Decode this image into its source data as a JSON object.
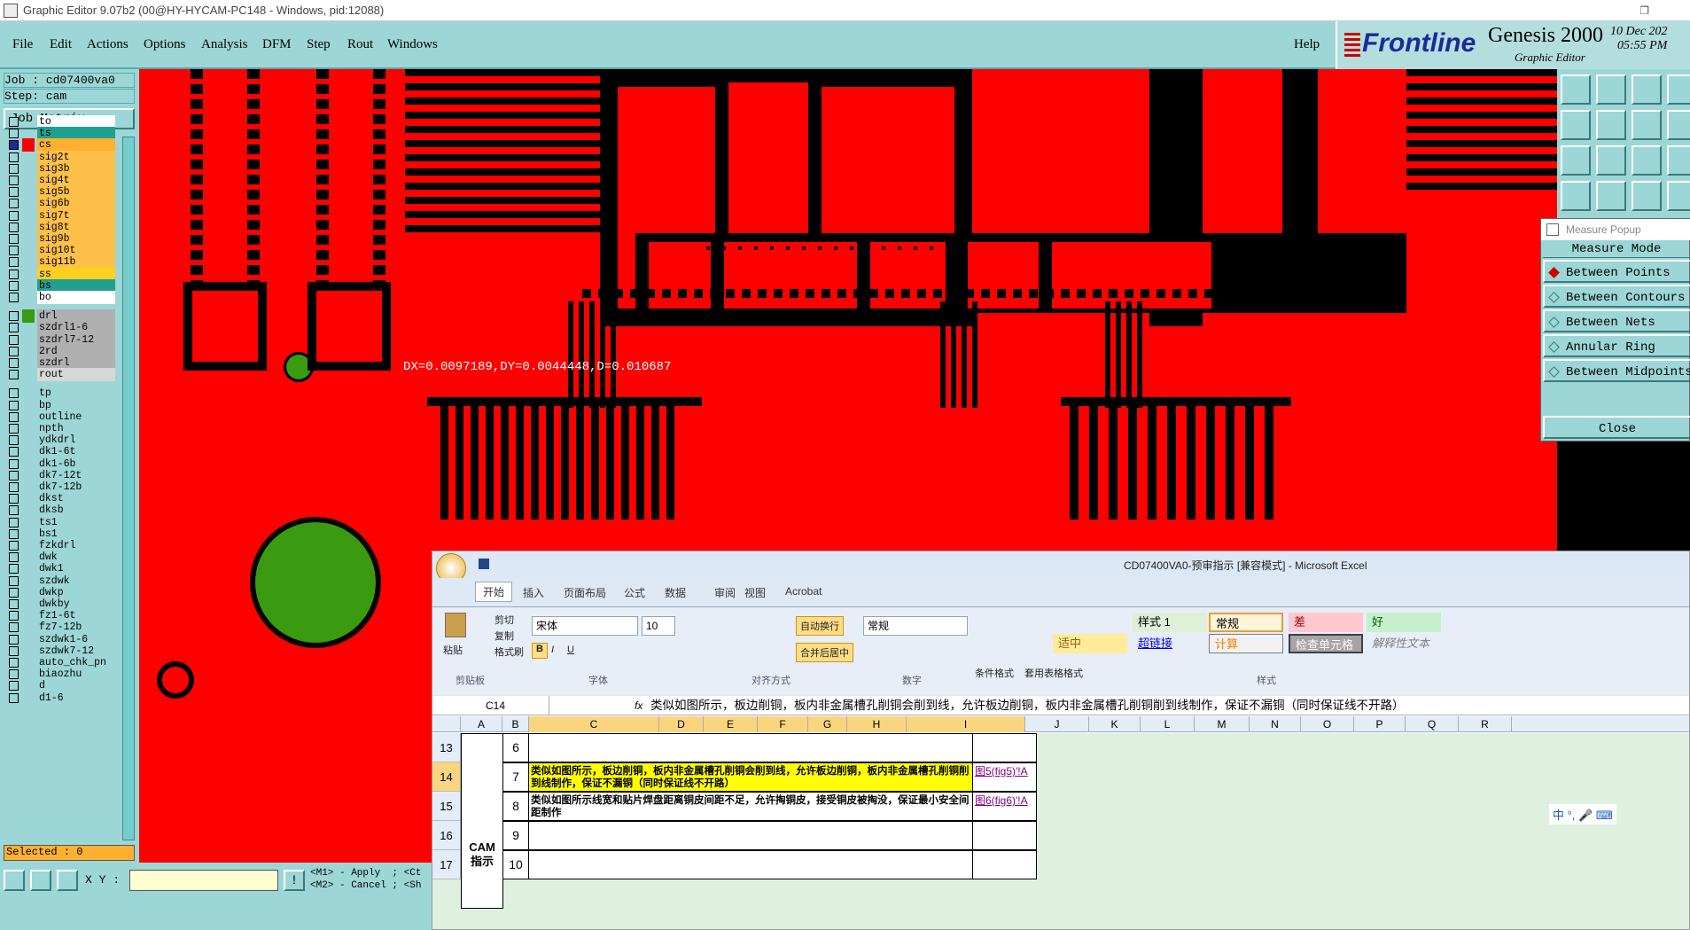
{
  "window": {
    "title": "Graphic Editor 9.07b2 (00@HY-HYCAM-PC148 - Windows, pid:12088)"
  },
  "menu": [
    "File",
    "Edit",
    "Actions",
    "Options",
    "Analysis",
    "DFM",
    "Step",
    "Rout",
    "Windows"
  ],
  "help_label": "Help",
  "brand": {
    "logo": "Frontline",
    "product": "Genesis 2000",
    "subtitle": "Graphic Editor",
    "date": "10 Dec 202",
    "time": "05:55 PM"
  },
  "job": {
    "job_label": "Job : cd07400va0",
    "step_label": "Step: cam",
    "matrix_button": "Job Matrix ..."
  },
  "layers_group1": [
    {
      "name": "to",
      "color": "#ffffff"
    },
    {
      "name": "ts",
      "color": "#20a090"
    },
    {
      "name": "cs",
      "color": "#ffb030"
    },
    {
      "name": "sig2t",
      "color": "#ffc04a"
    },
    {
      "name": "sig3b",
      "color": "#ffc04a"
    },
    {
      "name": "sig4t",
      "color": "#ffc04a"
    },
    {
      "name": "sig5b",
      "color": "#ffc04a"
    },
    {
      "name": "sig6b",
      "color": "#ffc04a"
    },
    {
      "name": "sig7t",
      "color": "#ffc04a"
    },
    {
      "name": "sig8t",
      "color": "#ffc04a"
    },
    {
      "name": "sig9b",
      "color": "#ffc04a"
    },
    {
      "name": "sig10t",
      "color": "#ffc04a"
    },
    {
      "name": "sig11b",
      "color": "#ffc04a"
    },
    {
      "name": "ss",
      "color": "#ffd020"
    },
    {
      "name": "bs",
      "color": "#20a090"
    },
    {
      "name": "bo",
      "color": "#ffffff"
    }
  ],
  "layers_group2": [
    {
      "name": "drl",
      "color": "#b0b0b0"
    },
    {
      "name": "szdrl1-6",
      "color": "#b0b0b0"
    },
    {
      "name": "szdrl7-12",
      "color": "#b0b0b0"
    },
    {
      "name": "2rd",
      "color": "#b0b0b0"
    },
    {
      "name": "szdrl",
      "color": "#b0b0b0"
    },
    {
      "name": "rout",
      "color": "#d8d8d8"
    }
  ],
  "layers_group3": [
    "tp",
    "bp",
    "outline",
    "npth",
    "ydkdrl",
    "dk1-6t",
    "dk1-6b",
    "dk7-12t",
    "dk7-12b",
    "dkst",
    "dksb",
    "ts1",
    "bs1",
    "fzkdrl",
    "dwk",
    "dwk1",
    "szdwk",
    "dwkp",
    "dwkby",
    "fz1-6t",
    "fz7-12b",
    "szdwk1-6",
    "szdwk7-12",
    "auto_chk_pn",
    "biaozhu",
    "d",
    "d1-6"
  ],
  "selected_label": "Selected : 0",
  "xy_label": "X Y :",
  "hints": {
    "line1": "<M1> - Apply  ; <Ct",
    "line2": "<M2> - Cancel ; <Sh"
  },
  "measure_readout": "DX=0.0097189,DY=0.0044448,D=0.010687",
  "measure_popup": {
    "title": "Measure Popup",
    "mode_header": "Measure Mode",
    "options": [
      "Between Points",
      "Between Contours",
      "Between Nets",
      "Annular Ring",
      "Between Midpoints"
    ],
    "close_label": "Close"
  },
  "excel": {
    "title": "CD07400VA0-预审指示 [兼容模式] - Microsoft Excel",
    "tabs": [
      "开始",
      "插入",
      "页面布局",
      "公式",
      "数据",
      "审阅",
      "视图",
      "Acrobat"
    ],
    "clipboard": {
      "paste": "粘贴",
      "cut": "剪切",
      "copy": "复制",
      "format_painter": "格式刷",
      "group": "剪贴板"
    },
    "font": {
      "name": "宋体",
      "size": "10",
      "group": "字体"
    },
    "alignment": {
      "wrap": "自动换行",
      "merge": "合并后居中",
      "group": "对齐方式"
    },
    "number": {
      "format": "常规",
      "group": "数字"
    },
    "styles": {
      "cond": "条件格式",
      "table": "套用表格格式",
      "group": "样式",
      "items": [
        "样式 1",
        "常规",
        "差",
        "好",
        "适中",
        "超链接",
        "计算",
        "检查单元格",
        "解释性文本"
      ]
    },
    "namebox": "C14",
    "formula": "类似如图所示，板边削铜，板内非金属槽孔削铜会削到线，允许板边削铜，板内非金属槽孔削铜削到线制作，保证不漏铜（同时保证线不开路）",
    "columns": [
      "A",
      "B",
      "C",
      "D",
      "E",
      "F",
      "G",
      "H",
      "I",
      "J",
      "K",
      "L",
      "M",
      "N",
      "O",
      "P",
      "Q",
      "R"
    ],
    "rows": [
      {
        "num": "13",
        "b": "6",
        "c": "",
        "j": ""
      },
      {
        "num": "14",
        "b": "7",
        "c": "类似如图所示，板边削铜，板内非金属槽孔削铜会削到线，允许板边削铜，板内非金属槽孔削铜削到线制作，保证不漏铜（同时保证线不开路）",
        "j": "图5(fig5)'!A"
      },
      {
        "num": "15",
        "b": "8",
        "c": "类似如图所示线宽和贴片焊盘距离铜皮间距不足，允许掏铜皮，接受铜皮被掏没，保证最小安全间距制作",
        "j": "图6(fig6)'!A"
      },
      {
        "num": "16",
        "b": "9",
        "c": "",
        "j": ""
      },
      {
        "num": "17",
        "b": "10",
        "c": "",
        "j": ""
      }
    ],
    "a_label": "CAM\n指示"
  },
  "ime": "中 °, 🎤 ⌨"
}
